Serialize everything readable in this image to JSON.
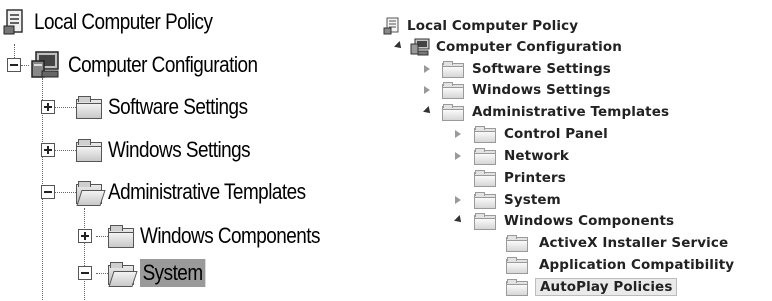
{
  "left_tree": {
    "root": "Local Computer Policy",
    "computer_configuration": "Computer Configuration",
    "software_settings": "Software Settings",
    "windows_settings": "Windows Settings",
    "administrative_templates": "Administrative Templates",
    "windows_components": "Windows Components",
    "system": "System",
    "selected_item": "System"
  },
  "right_tree": {
    "root": "Local Computer Policy",
    "computer_configuration": "Computer Configuration",
    "software_settings": "Software Settings",
    "windows_settings": "Windows Settings",
    "administrative_templates": "Administrative Templates",
    "control_panel": "Control Panel",
    "network": "Network",
    "printers": "Printers",
    "system": "System",
    "windows_components": "Windows Components",
    "activex_installer_service": "ActiveX Installer Service",
    "application_compatibility": "Application Compatibility",
    "autoplay_policies": "AutoPlay Policies",
    "selected_item": "AutoPlay Policies"
  },
  "icons": {
    "policy_document": "policy-document-icon",
    "computer": "computer-icon",
    "folder": "folder-icon",
    "folder_open": "folder-open-icon",
    "expand": "plus-box-icon",
    "collapse": "minus-box-icon",
    "expand_triangle": "expand-triangle-icon",
    "collapse_triangle": "collapse-triangle-icon"
  }
}
